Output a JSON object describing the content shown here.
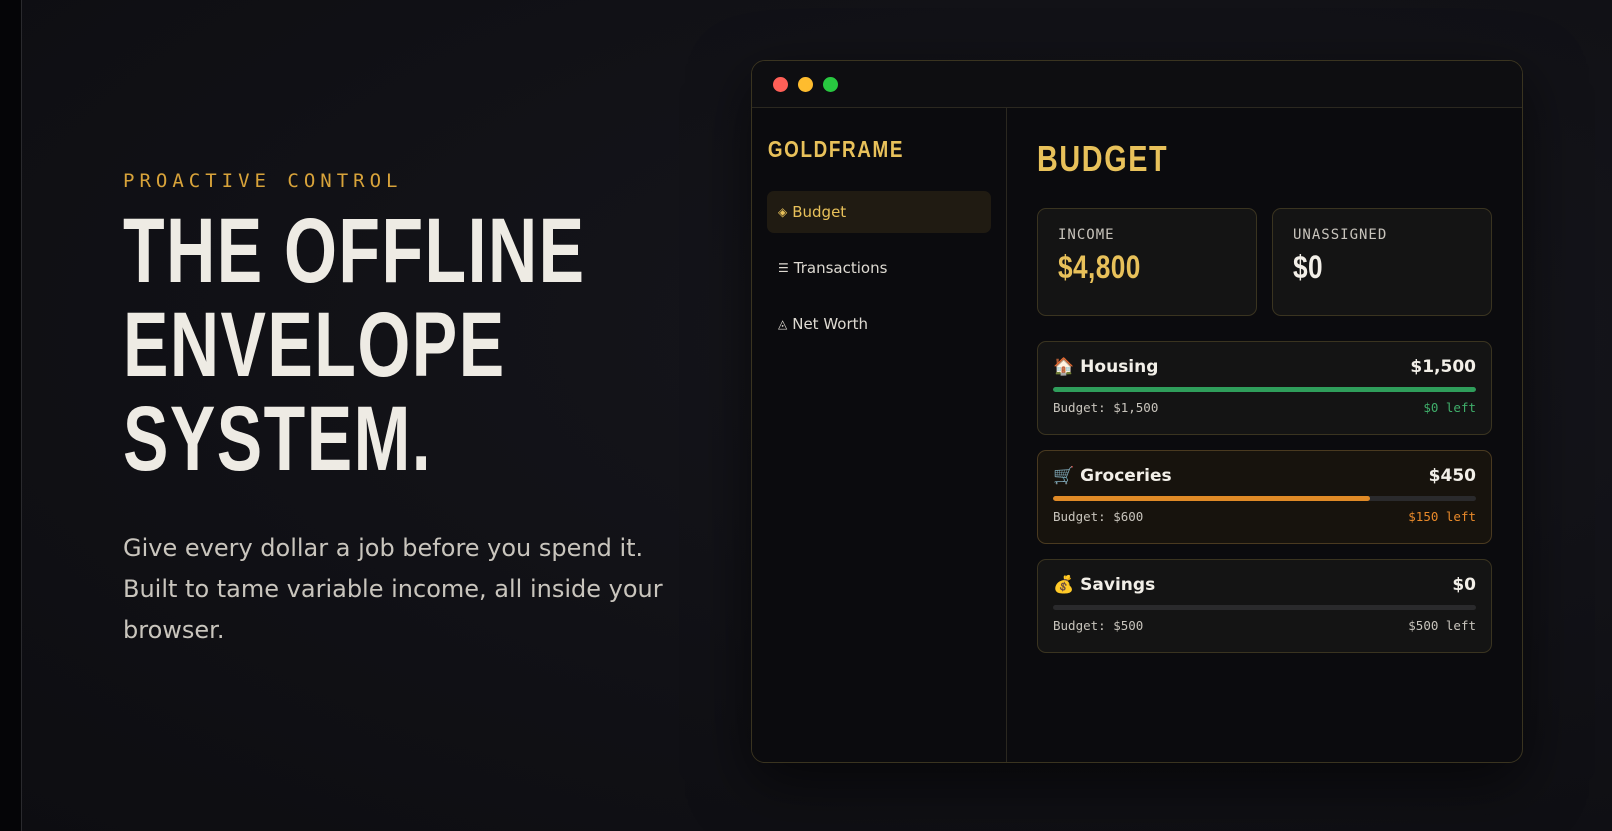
{
  "hero": {
    "eyebrow": "PROACTIVE CONTROL",
    "headline_lines": [
      "THE OFFLINE",
      "ENVELOPE",
      "SYSTEM."
    ],
    "subtitle": "Give every dollar a job before you spend it. Built to tame variable income, all inside your browser."
  },
  "window": {
    "dots": [
      "#ff5f57",
      "#febc2e",
      "#28c840"
    ]
  },
  "sidebar": {
    "brand": "GOLDFRAME",
    "items": [
      {
        "icon": "◈",
        "icon_name": "diamond-icon",
        "label": "Budget",
        "active": true
      },
      {
        "icon": "☰",
        "icon_name": "list-icon",
        "label": "Transactions",
        "active": false
      },
      {
        "icon": "◬",
        "icon_name": "triangle-icon",
        "label": "Net Worth",
        "active": false
      }
    ]
  },
  "main": {
    "title": "BUDGET",
    "stats": [
      {
        "label": "INCOME",
        "value": "$4,800",
        "color": "#e8c15a"
      },
      {
        "label": "UNASSIGNED",
        "value": "$0",
        "color": "#f2efe8"
      }
    ],
    "envelopes": [
      {
        "emoji": "🏠",
        "icon_name": "house-icon",
        "name": "Housing",
        "amount": "$1,500",
        "budget": "Budget: $1,500",
        "left": "$0 left",
        "progress": 1.0,
        "bar_color": "#2f9e5b",
        "left_color": "#3fae6a",
        "warn": false
      },
      {
        "emoji": "🛒",
        "icon_name": "cart-icon",
        "name": "Groceries",
        "amount": "$450",
        "budget": "Budget: $600",
        "left": "$150 left",
        "progress": 0.75,
        "bar_color": "#e08a26",
        "left_color": "#e8892a",
        "warn": true
      },
      {
        "emoji": "💰",
        "icon_name": "money-bag-icon",
        "name": "Savings",
        "amount": "$0",
        "budget": "Budget: $500",
        "left": "$500 left",
        "progress": 0.0,
        "bar_color": "#e8c15a",
        "left_color": "#c8c4bc",
        "warn": false
      }
    ]
  }
}
